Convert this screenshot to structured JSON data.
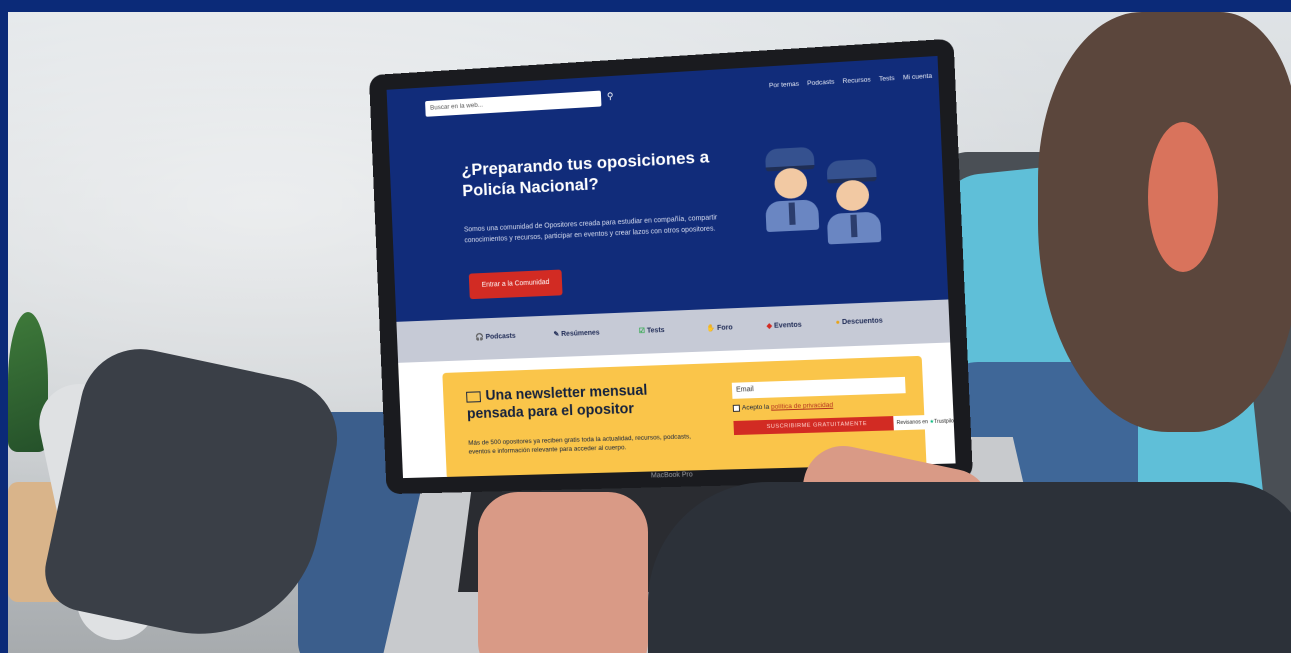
{
  "screen": {
    "search": {
      "placeholder": "Buscar en la web..."
    },
    "nav": {
      "links": [
        "Por temas",
        "Podcasts",
        "Recursos",
        "Tests",
        "Mi cuenta"
      ]
    },
    "hero": {
      "title": "¿Preparando tus oposiciones a Policía Nacional?",
      "text": "Somos una comunidad de Opositores creada para estudiar en compañía, compartir conocimientos y recursos, participar en eventos y crear lazos con otros opositores.",
      "button": "Entrar a la Comunidad"
    },
    "categories": [
      {
        "label": "Podcasts",
        "icon": "headphones-icon"
      },
      {
        "label": "Resúmenes",
        "icon": "pencil-icon"
      },
      {
        "label": "Tests",
        "icon": "check-icon"
      },
      {
        "label": "Foro",
        "icon": "hand-icon"
      },
      {
        "label": "Eventos",
        "icon": "diamond-icon"
      },
      {
        "label": "Descuentos",
        "icon": "coin-icon"
      }
    ],
    "newsletter": {
      "title": "Una newsletter mensual pensada para el opositor",
      "text": "Más de 500 opositores ya reciben gratis toda la actualidad, recursos, podcasts, eventos e información relevante para acceder al cuerpo.",
      "email_placeholder": "Email",
      "accept_prefix": "Acepto la",
      "accept_link": "política de privacidad",
      "button": "SUSCRIBIRME GRATUITAMENTE",
      "trust": "Revisanos en",
      "trust_brand": "Trustpilot"
    },
    "laptop_label": "MacBook Pro"
  },
  "colors": {
    "frame": "#0b2a78",
    "site_primary": "#112c7a",
    "accent_red": "#d22b23",
    "newsletter_bg": "#fac54a",
    "category_bar": "#c6cad6"
  }
}
